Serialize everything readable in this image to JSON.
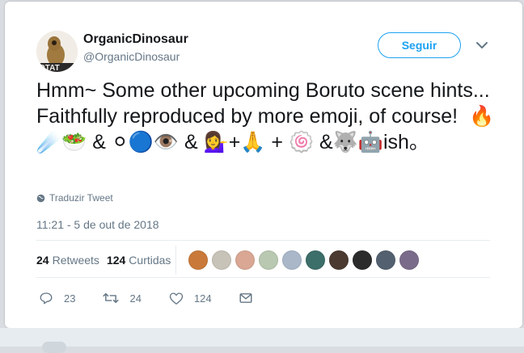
{
  "user": {
    "display_name": "OrganicDinosaur",
    "handle": "@OrganicDinosaur",
    "avatar_text": "OTAT"
  },
  "follow_button": {
    "label": "Seguir"
  },
  "tweet": {
    "text": "Hmm~ Some other upcoming Boruto scene hints... Faithfully reproduced by more emoji, of course!  🔥☄️🥗 & ⚪🔵👁️ & 💁‍♀️+🙏 + 🍥 &🐺🤖ish。",
    "translate_label": "Traduzir Tweet",
    "timestamp": "11:21 - 5 de out de 2018"
  },
  "stats": {
    "retweets_count": "24",
    "retweets_label": "Retweets",
    "likes_count": "124",
    "likes_label": "Curtidas"
  },
  "liker_avatars": [
    {
      "color": "#c97a3a"
    },
    {
      "color": "#c8c3b8"
    },
    {
      "color": "#d9a793"
    },
    {
      "color": "#b9c8b0"
    },
    {
      "color": "#a9b7c9"
    },
    {
      "color": "#3c6e6a"
    },
    {
      "color": "#4a3a30"
    },
    {
      "color": "#2b2b2b"
    },
    {
      "color": "#53606f"
    },
    {
      "color": "#7b6b8a"
    }
  ],
  "actions": {
    "reply_count": "23",
    "retweet_count": "24",
    "like_count": "124"
  },
  "colors": {
    "accent": "#1da1f2",
    "muted": "#657786"
  }
}
